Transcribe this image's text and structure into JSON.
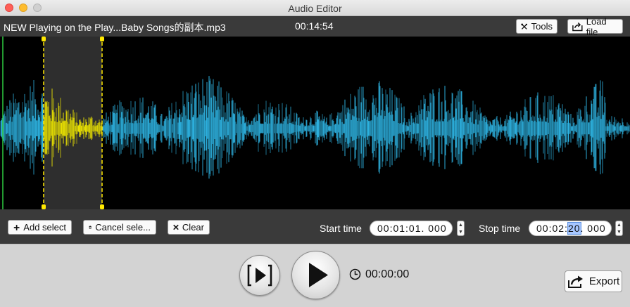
{
  "window": {
    "title": "Audio Editor"
  },
  "info": {
    "filename": "NEW Playing on the Play...Baby Songs的副本.mp3",
    "duration": "00:14:54"
  },
  "toolbar": {
    "tools_label": "Tools",
    "load_label": "Load file"
  },
  "selection_bar": {
    "add_label": "Add select",
    "cancel_label": "Cancel sele...",
    "clear_label": "Clear",
    "start_label": "Start time",
    "start_value": "00:01:01. 000",
    "stop_label": "Stop time",
    "stop_value_pre": "00:02:",
    "stop_value_sel": "20",
    "stop_value_post": ". 000"
  },
  "playback": {
    "elapsed": "00:00:00",
    "export_label": "Export"
  },
  "colors": {
    "wave": "#2fb8e8",
    "selection_wave": "#f0e800",
    "selection_marker": "#ffe800",
    "playhead": "#2ecc40"
  },
  "icons": [
    "tools-icon",
    "load-file-icon",
    "plus-icon",
    "trash-icon",
    "close-x-icon",
    "play-selection-icon",
    "play-icon",
    "clock-icon",
    "export-icon"
  ]
}
